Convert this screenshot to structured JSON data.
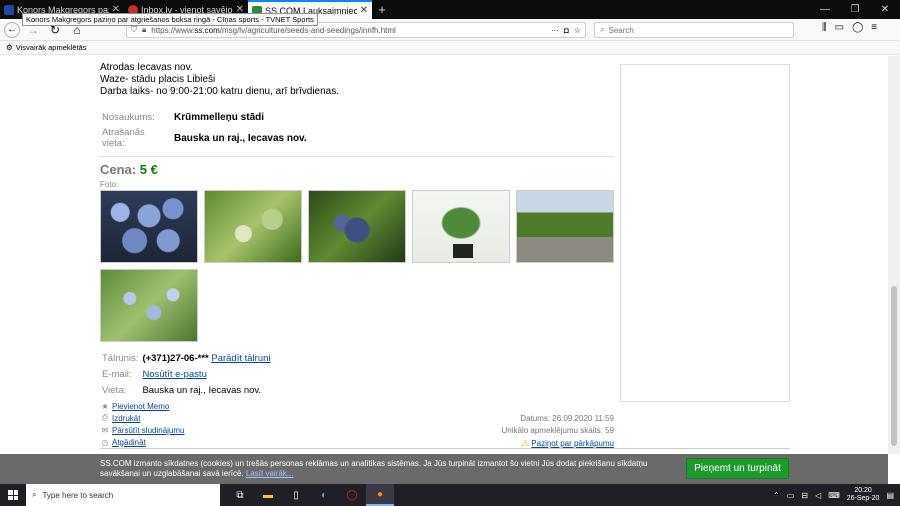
{
  "browser": {
    "tabs": [
      {
        "title": "Konors Makgregors paziņo par",
        "color": "#1a4da1",
        "active": false
      },
      {
        "title": "Inbox.lv - vienot savējos lielā",
        "color": "#c4302b",
        "active": false
      },
      {
        "title": "SS.COM Lauksaimniecība - Sēk",
        "color": "#2b8a3e",
        "active": true
      }
    ],
    "tooltip": "Konors Makgregors paziņo par atgriešanos boksa ringā - Cīņas sports - TVNET Sports",
    "url_prefix": "https://www.",
    "url_host": "ss.com",
    "url_path": "/msg/lv/agriculture/seeds-and-seedings/innfh.html",
    "search_placeholder": "Search",
    "bookmark": "Visvairāk apmeklētās"
  },
  "listing": {
    "desc_lines": [
      "Atrodas Iecavas nov.",
      "Waze- stādu placis Libieši",
      "Darba laiks- no 9:00-21:00 katru dienu, arī brīvdienas."
    ],
    "name_label": "Nosaukums:",
    "name_value": "Krūmmelleņu stādi",
    "location_label": "Atrašanās vieta:",
    "location_value": "Bauska un raj., Iecavas nov.",
    "price_label": "Cena:",
    "price_value": "5 €",
    "foto_label": "Foto:",
    "phone_label": "Tālrunis:",
    "phone_value": "(+371)27-06-***",
    "phone_link": "Parādīt tālruni",
    "email_label": "E-mail:",
    "email_link": "Nosūtīt e-pastu",
    "place_label": "Vieta:",
    "place_value": "Bauska un raj., Iecavas nov."
  },
  "actions": {
    "memo": "Pievienot Memo",
    "print": "Izdrukāt",
    "forward": "Pārsūtīt sludinājumu",
    "remind": "Atgādināt",
    "date": "Datums: 26.09.2020 11:59",
    "views": "Unikālo apmeklējumu skaits: 59",
    "report": "Paziņot par pārkāpumu"
  },
  "cookie": {
    "text": "SS.COM izmanto sīkdatnes (cookies) un trešās personas reklāmas un analītikas sistēmas. Ja Jūs turpināt izmantot šo vietni Jūs dodat piekrišanu sīkdatņu savākšanai un uzglabāšanai savā ierīcē.",
    "more": "Lasīt vairāk...",
    "accept": "Pieņemt un turpināt"
  },
  "taskbar": {
    "search_placeholder": "Type here to search",
    "time": "20:20",
    "date": "26-Sep-20"
  }
}
